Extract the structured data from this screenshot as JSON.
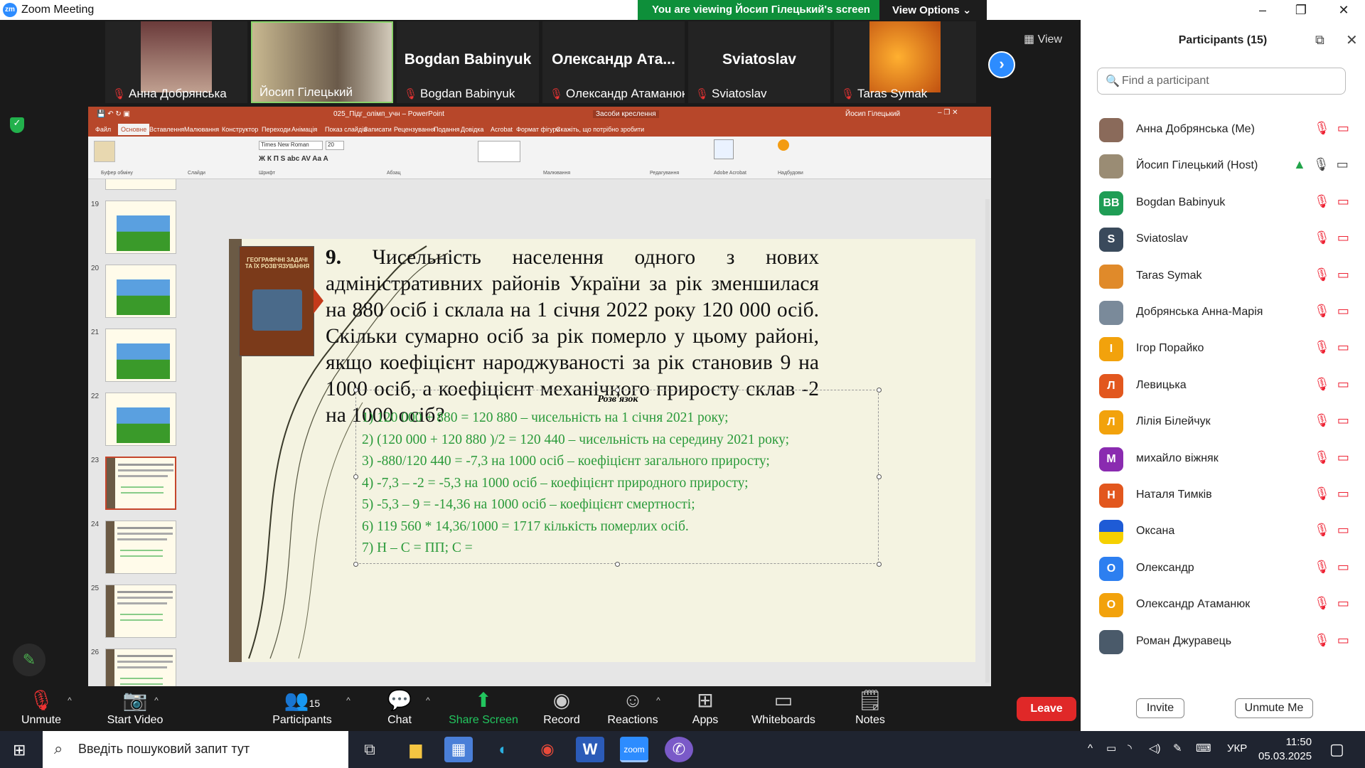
{
  "window": {
    "title": "Zoom Meeting",
    "logo": "zm"
  },
  "banner": {
    "viewing": "You are viewing Йосип Гілецький's screen",
    "view_options": "View Options"
  },
  "video_thumbs": [
    {
      "name": "Анна Добрянська",
      "type": "photo",
      "color": "#8a6a5a"
    },
    {
      "name": "Йосип Гілецький",
      "type": "photo",
      "color": "#9a8c74",
      "active": true
    },
    {
      "name": "Bogdan Babinyuk",
      "type": "text"
    },
    {
      "name": "Олександр Атаманюк",
      "display": "Олександр  Ата...",
      "type": "text"
    },
    {
      "name": "Sviatoslav",
      "type": "text"
    },
    {
      "name": "Taras Symak",
      "type": "photo",
      "color": "#e08a2a"
    }
  ],
  "view_label": "View",
  "ppt": {
    "file_title": "025_Підг_олімп_учн – PowerPoint",
    "tools_label": "Засоби креслення",
    "user": "Йосип Гілецький",
    "tabs": [
      "Файл",
      "Основне",
      "Вставлення",
      "Малювання",
      "Конструктор",
      "Переходи",
      "Анімація",
      "Показ слайдів",
      "Записати",
      "Рецензування",
      "Подання",
      "Довідка",
      "Acrobat",
      "Формат фігури"
    ],
    "tell_me": "Скажіть, що потрібно зробити",
    "groups": [
      "Буфер обміну",
      "Слайди",
      "Шрифт",
      "Абзац",
      "Малювання",
      "Редагування",
      "Adobe Acrobat",
      "Надбудови"
    ],
    "font": "Times New Roman",
    "font_size": "20"
  },
  "slide_numbers": [
    "19",
    "20",
    "21",
    "22",
    "23",
    "24",
    "25",
    "26"
  ],
  "slide": {
    "book_title": "ГЕОГРАФІЧНІ ЗАДАЧІ ТА ЇХ РОЗВ'ЯЗУВАННЯ",
    "question_num": "9.",
    "question": " Чисельність населення одного з нових адміністративних районів України за рік зменшилася на 880 осіб і склала на 1 січня 2022 року 120 000 осіб. Скільки сумарно осіб за рік померло у цьому районі, якщо коефіцієнт народжуваності за рік становив 9 на 1000 осіб, а коефіцієнт механічного приросту склав -2 на 1000 осіб?",
    "solution_title": "Розв'язок",
    "steps": [
      "1)  120 000 + 880  = 120 880 – чисельність на 1 січня 2021 року;",
      "2)  (120 000 + 120 880 )/2 = 120 440 – чисельність на середину 2021 року;",
      "3)  -880/120 440 = -7,3 на 1000 осіб – коефіцієнт загального приросту;",
      "4)  -7,3 – -2 = -5,3 на 1000 осіб – коефіцієнт природного приросту;",
      "5)  -5,3 – 9 = -14,36 на 1000 осіб – коефіцієнт смертності;",
      "6)  119 560 * 14,36/1000 = 1717 кількість померлих осіб.",
      "7)  Н – С = ПП; С ="
    ]
  },
  "participants": {
    "header": "Participants (15)",
    "search_placeholder": "Find a participant",
    "list": [
      {
        "name": "Анна Добрянська (Me)",
        "initial": "",
        "color": "#8a6a5a"
      },
      {
        "name": "Йосип Гілецький (Host)",
        "initial": "",
        "color": "#9a8c74",
        "host": true
      },
      {
        "name": "Bogdan Babinyuk",
        "initial": "BB",
        "color": "#1f9d55"
      },
      {
        "name": "Sviatoslav",
        "initial": "S",
        "color": "#3a4a5c"
      },
      {
        "name": "Taras Symak",
        "initial": "",
        "color": "#e08a2a"
      },
      {
        "name": "Добрянська Анна-Марія",
        "initial": "",
        "color": "#7a8a9a"
      },
      {
        "name": "Ігор Порайко",
        "initial": "І",
        "color": "#f2a20c"
      },
      {
        "name": "Левицька",
        "initial": "Л",
        "color": "#e2571e"
      },
      {
        "name": "Лілія Білейчук",
        "initial": "Л",
        "color": "#f2a20c"
      },
      {
        "name": "михайло віжняк",
        "initial": "М",
        "color": "#8a2bb0"
      },
      {
        "name": "Наталя Тимків",
        "initial": "Н",
        "color": "#e2571e"
      },
      {
        "name": "Оксана",
        "initial": "",
        "color": "#1e5bd6"
      },
      {
        "name": "Олександр",
        "initial": "О",
        "color": "#2d7ff0"
      },
      {
        "name": "Олександр Атаманюк",
        "initial": "О",
        "color": "#f2a20c"
      },
      {
        "name": "Роман Джуравець",
        "initial": "",
        "color": "#4a5a6a"
      }
    ],
    "invite": "Invite",
    "unmute_me": "Unmute Me"
  },
  "toolbar": {
    "unmute": "Unmute",
    "start_video": "Start Video",
    "participants": "Participants",
    "participants_count": "15",
    "chat": "Chat",
    "share_screen": "Share Screen",
    "record": "Record",
    "reactions": "Reactions",
    "apps": "Apps",
    "whiteboards": "Whiteboards",
    "notes": "Notes",
    "leave": "Leave"
  },
  "taskbar": {
    "search": "Введіть пошуковий запит тут",
    "lang": "УКР",
    "time": "11:50",
    "date": "05.03.2025"
  }
}
